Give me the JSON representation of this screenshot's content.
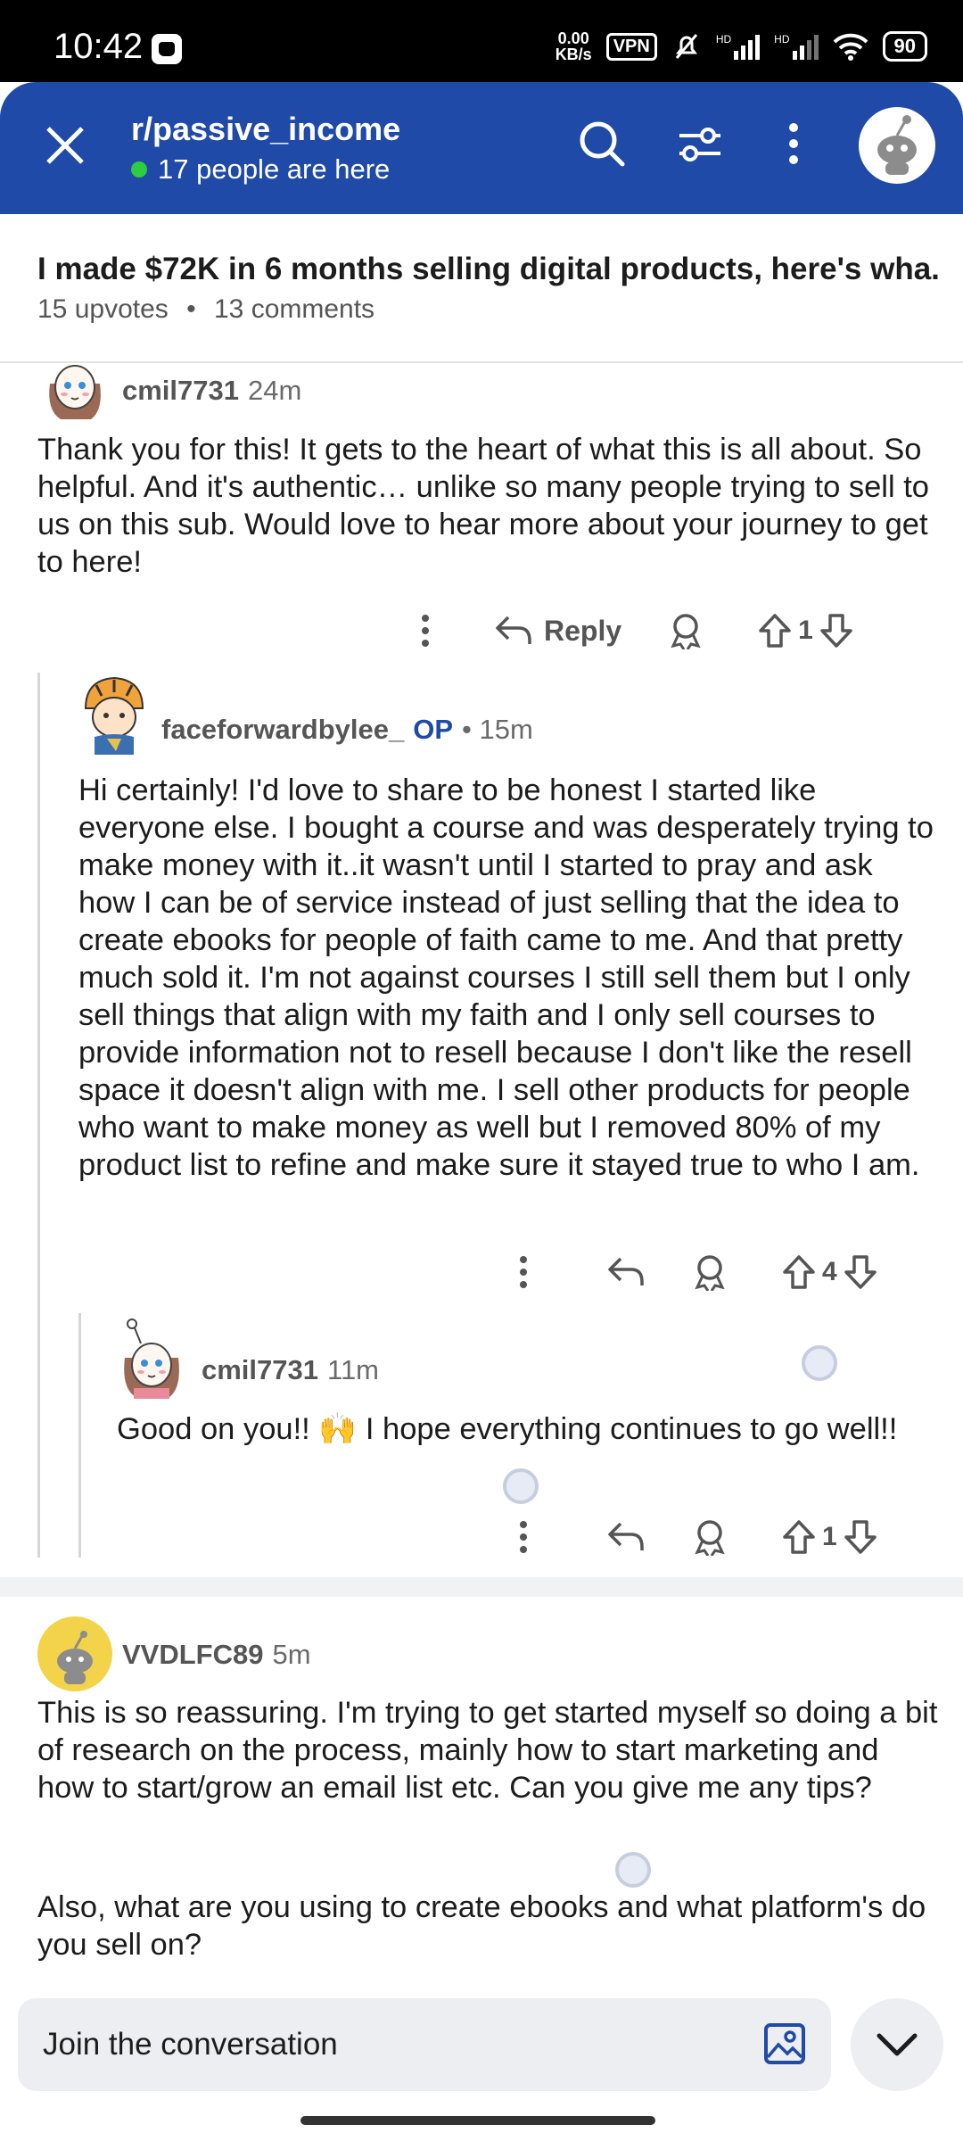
{
  "status_bar": {
    "time": "10:42",
    "net_speed_top": "0.00",
    "net_speed_bottom": "KB/s",
    "vpn": "VPN",
    "hd1": "HD",
    "hd2": "HD",
    "battery": "90"
  },
  "header": {
    "subreddit": "r/passive_income",
    "online": "17 people are here"
  },
  "post": {
    "title": "I made $72K in 6 months selling digital products, here's wha...",
    "upvotes": "15 upvotes",
    "dot": "•",
    "comments": "13 comments"
  },
  "comments": [
    {
      "author": "cmil7731",
      "time": "24m",
      "text": "Thank you for this! It gets to the heart of what this is all about. So helpful. And it's authentic… unlike so many people trying to sell to us on this sub. Would love to hear more about your journey to get to here!",
      "reply_label": "Reply",
      "votes": "1"
    },
    {
      "author": "faceforwardbylee_",
      "op": "OP",
      "time": "• 15m",
      "text": "Hi certainly! I'd love to share to be honest I started like everyone else. I bought a course and was desperately trying to make money with it..it wasn't until I started to pray and ask how I can be of service instead of just selling that the idea to create ebooks for people of faith came to me. And that pretty much sold it. I'm not against courses I still sell them but I only sell things that align with my faith and I only sell courses to provide information not to resell because I don't like the resell space it doesn't align with me. I sell other products for people who want to make money as well but I removed 80% of my product list to refine and make sure it stayed true to who I am.",
      "votes": "4"
    },
    {
      "author": "cmil7731",
      "time": "11m",
      "text": "Good on you!! 🙌 I hope everything continues to go well!!",
      "votes": "1"
    },
    {
      "author": "VVDLFC89",
      "time": "5m",
      "text_p1": "This is so reassuring. I'm trying to get started myself so doing a bit of research on the process, mainly how to start marketing and how to start/grow an email list etc. Can you give me any tips?",
      "text_p2": "Also, what are you using to create ebooks and what platform's do you sell on?"
    }
  ],
  "composer": {
    "placeholder": "Join the conversation"
  },
  "colors": {
    "header_bg": "#1f4aa8",
    "op_badge": "#1f4aa8",
    "online": "#2ecc40"
  }
}
